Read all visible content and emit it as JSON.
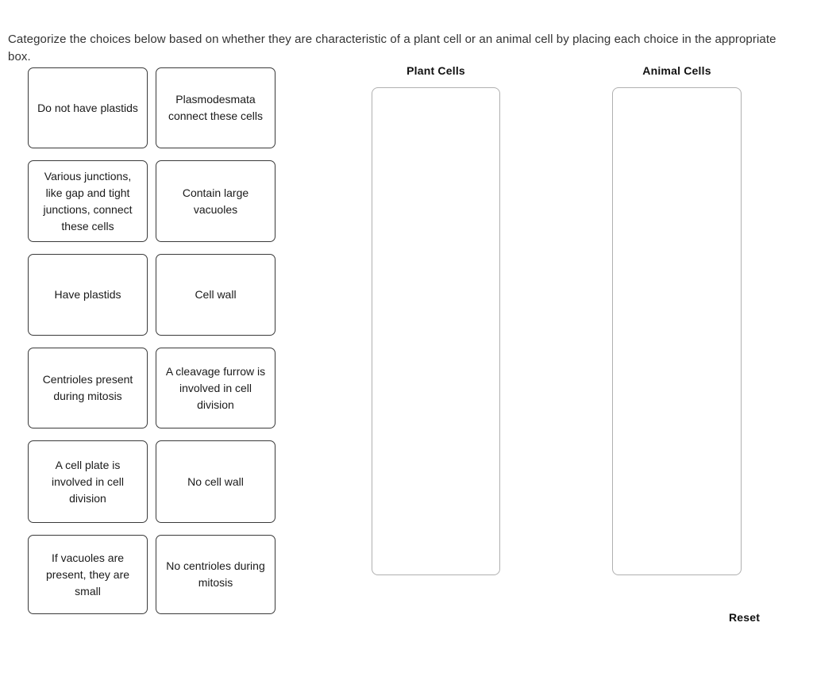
{
  "prompt": {
    "text": "Categorize the choices below based on whether they are characteristic of a plant cell or an animal cell by placing each choice in the appropriate box."
  },
  "choices": [
    {
      "id": "do-not-have-plastids",
      "label": "Do not have plastids"
    },
    {
      "id": "plasmodesmata-connect",
      "label": "Plasmodesmata connect these cells"
    },
    {
      "id": "various-junctions",
      "label": "Various junctions, like gap and tight junctions, connect these cells"
    },
    {
      "id": "contain-large-vacuoles",
      "label": "Contain large vacuoles"
    },
    {
      "id": "have-plastids",
      "label": "Have plastids"
    },
    {
      "id": "cell-wall",
      "label": "Cell wall"
    },
    {
      "id": "centrioles-present",
      "label": "Centrioles present during mitosis"
    },
    {
      "id": "cleavage-furrow",
      "label": "A cleavage furrow is involved in cell division"
    },
    {
      "id": "cell-plate",
      "label": "A cell plate is involved in cell division"
    },
    {
      "id": "no-cell-wall",
      "label": "No cell wall"
    },
    {
      "id": "vacuoles-small",
      "label": "If vacuoles are present, they are small"
    },
    {
      "id": "no-centrioles",
      "label": "No centrioles during mitosis"
    }
  ],
  "dropzones": [
    {
      "id": "plant-cells",
      "title": "Plant Cells",
      "items": []
    },
    {
      "id": "animal-cells",
      "title": "Animal Cells",
      "items": []
    }
  ],
  "reset": {
    "label": "Reset"
  },
  "colors": {
    "page_background": "#ffffff",
    "prompt_text": "#333333",
    "tile_border": "#3a3a3a",
    "tile_text": "#1a1a1a",
    "dropzone_border": "#b0b0b0",
    "heading_text": "#111111"
  }
}
